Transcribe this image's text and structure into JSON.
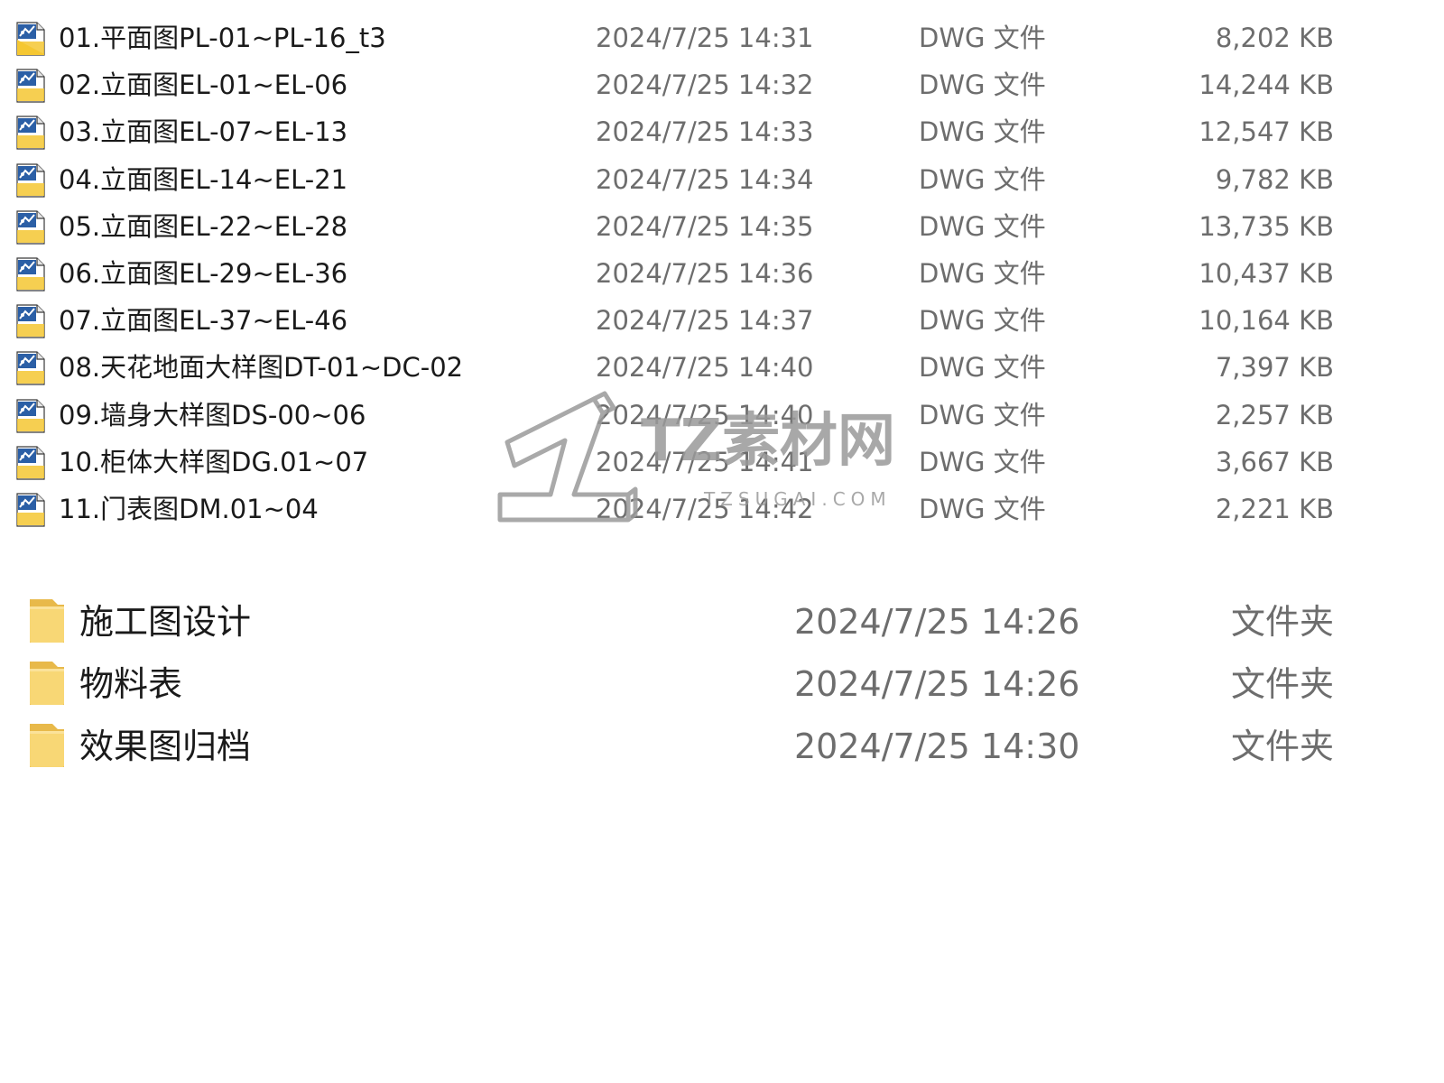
{
  "files": [
    {
      "name": "01.平面图PL-01~PL-16_t3",
      "date": "2024/7/25 14:31",
      "type": "DWG 文件",
      "size": "8,202 KB",
      "icon": "dwg-file-icon"
    },
    {
      "name": "02.立面图EL-01~EL-06",
      "date": "2024/7/25 14:32",
      "type": "DWG 文件",
      "size": "14,244 KB",
      "icon": "dwg-file-icon"
    },
    {
      "name": "03.立面图EL-07~EL-13",
      "date": "2024/7/25 14:33",
      "type": "DWG 文件",
      "size": "12,547 KB",
      "icon": "dwg-file-icon"
    },
    {
      "name": "04.立面图EL-14~EL-21",
      "date": "2024/7/25 14:34",
      "type": "DWG 文件",
      "size": "9,782 KB",
      "icon": "dwg-file-icon"
    },
    {
      "name": "05.立面图EL-22~EL-28",
      "date": "2024/7/25 14:35",
      "type": "DWG 文件",
      "size": "13,735 KB",
      "icon": "dwg-file-icon"
    },
    {
      "name": "06.立面图EL-29~EL-36",
      "date": "2024/7/25 14:36",
      "type": "DWG 文件",
      "size": "10,437 KB",
      "icon": "dwg-file-icon"
    },
    {
      "name": "07.立面图EL-37~EL-46",
      "date": "2024/7/25 14:37",
      "type": "DWG 文件",
      "size": "10,164 KB",
      "icon": "dwg-file-icon"
    },
    {
      "name": "08.天花地面大样图DT-01~DC-02",
      "date": "2024/7/25 14:40",
      "type": "DWG 文件",
      "size": "7,397 KB",
      "icon": "dwg-file-icon"
    },
    {
      "name": "09.墙身大样图DS-00~06",
      "date": "2024/7/25 14:40",
      "type": "DWG 文件",
      "size": "2,257 KB",
      "icon": "dwg-file-icon"
    },
    {
      "name": "10.柜体大样图DG.01~07",
      "date": "2024/7/25 14:41",
      "type": "DWG 文件",
      "size": "3,667 KB",
      "icon": "dwg-file-icon"
    },
    {
      "name": "11.门表图DM.01~04",
      "date": "2024/7/25 14:42",
      "type": "DWG 文件",
      "size": "2,221 KB",
      "icon": "dwg-file-icon"
    }
  ],
  "folders": [
    {
      "name": "施工图设计",
      "date": "2024/7/25 14:26",
      "type": "文件夹",
      "icon": "folder-icon"
    },
    {
      "name": "物料表",
      "date": "2024/7/25 14:26",
      "type": "文件夹",
      "icon": "folder-icon"
    },
    {
      "name": "效果图归档",
      "date": "2024/7/25 14:30",
      "type": "文件夹",
      "icon": "folder-icon"
    }
  ],
  "watermark": {
    "brand": "TZ素材网",
    "url": "TZSUGAI.COM"
  },
  "colors": {
    "text": "#1a1a1a",
    "secondary_text": "#6d6d6d",
    "folder_yellow": "#f8d775",
    "folder_yellow_dark": "#e8b94a",
    "dwg_blue": "#2b5fa6",
    "dwg_yellow": "#f5c733",
    "watermark_gray": "#9a9a9a"
  }
}
